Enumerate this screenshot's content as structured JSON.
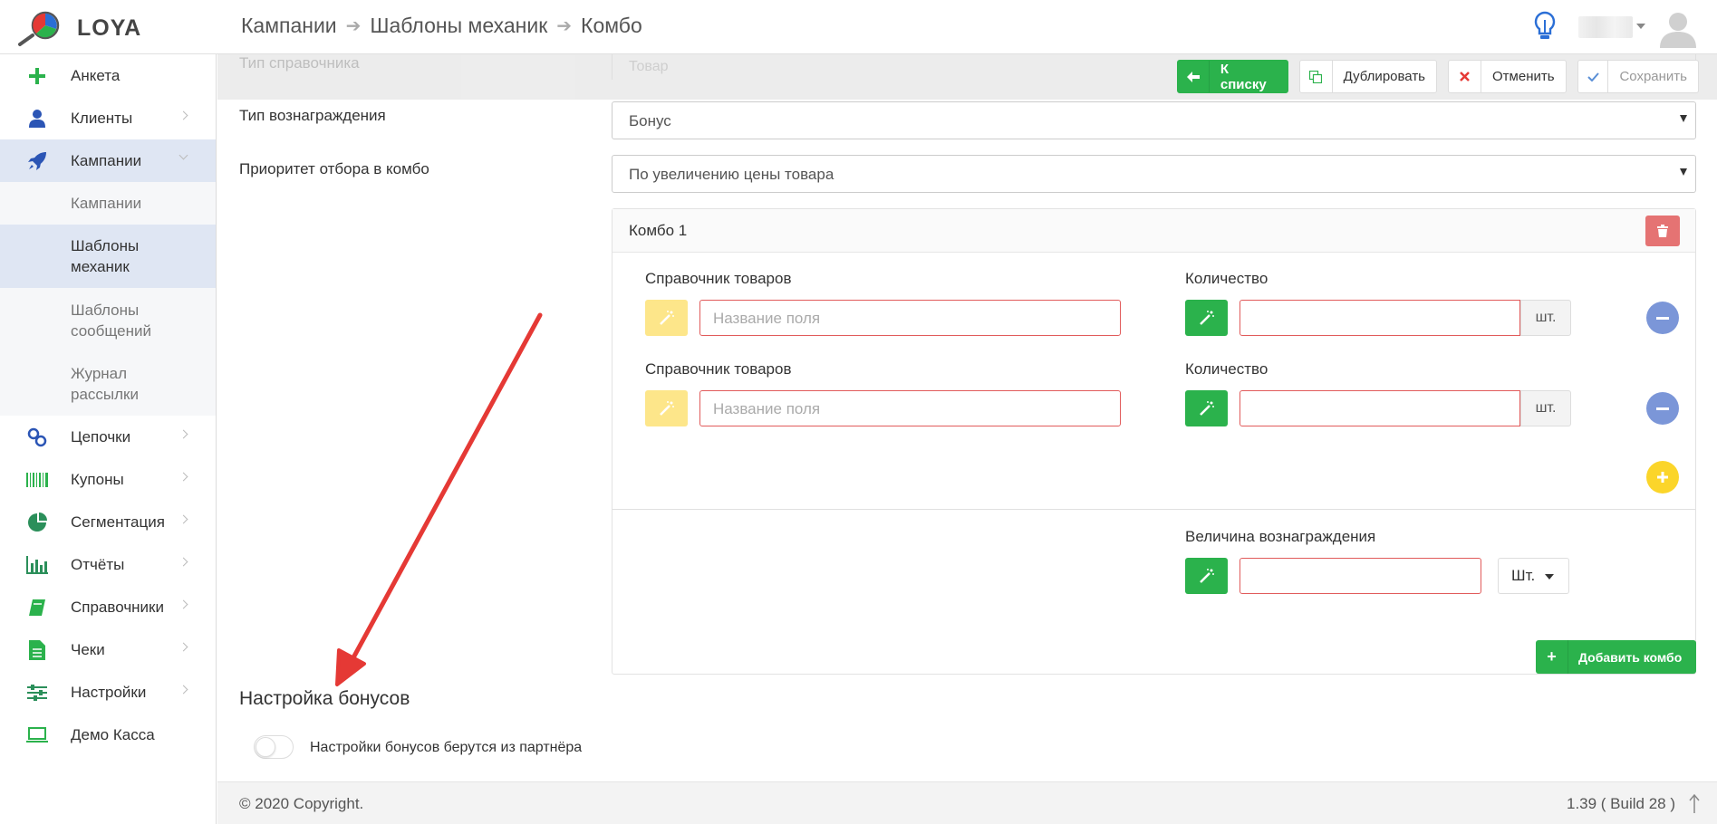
{
  "app": {
    "name": "LOYA"
  },
  "breadcrumb": {
    "items": [
      "Кампании",
      "Шаблоны механик",
      "Комбо"
    ]
  },
  "sidebar": {
    "items": [
      {
        "label": "Анкета",
        "icon": "plus-icon"
      },
      {
        "label": "Клиенты",
        "icon": "user-icon"
      },
      {
        "label": "Кампании",
        "icon": "rocket-icon"
      },
      {
        "label": "Цепочки",
        "icon": "link-icon"
      },
      {
        "label": "Купоны",
        "icon": "barcode-icon"
      },
      {
        "label": "Сегментация",
        "icon": "pie-chart-icon"
      },
      {
        "label": "Отчёты",
        "icon": "bar-chart-icon"
      },
      {
        "label": "Справочники",
        "icon": "book-icon"
      },
      {
        "label": "Чеки",
        "icon": "receipt-icon"
      },
      {
        "label": "Настройки",
        "icon": "sliders-icon"
      },
      {
        "label": "Демо Касса",
        "icon": "laptop-icon"
      }
    ],
    "sub_items": [
      "Кампании",
      "Шаблоны механик",
      "Шаблоны сообщений",
      "Журнал рассылки"
    ]
  },
  "toolbar": {
    "back_label": "К списку",
    "duplicate_label": "Дублировать",
    "cancel_label": "Отменить",
    "save_label": "Сохранить"
  },
  "form": {
    "ref_type_label": "Тип справочника",
    "ref_type_value": "Товар",
    "reward_type_label": "Тип вознаграждения",
    "reward_type_value": "Бонус",
    "priority_label": "Приоритет отбора в комбо",
    "priority_value": "По увеличению цены товара"
  },
  "combo": {
    "title": "Комбо 1",
    "rows": [
      {
        "catalog_label": "Справочник товаров",
        "catalog_placeholder": "Название поля",
        "qty_label": "Количество",
        "unit": "шт."
      },
      {
        "catalog_label": "Справочник товаров",
        "catalog_placeholder": "Название поля",
        "qty_label": "Количество",
        "unit": "шт."
      }
    ],
    "reward_label": "Величина вознаграждения",
    "reward_unit": "Шт."
  },
  "add_combo_label": "Добавить комбо",
  "bonus_settings": {
    "title": "Настройка бонусов",
    "toggle_label": "Настройки бонусов берутся из партнёра"
  },
  "footer": {
    "copyright": "© 2020 Copyright.",
    "build": "1.39 ( Build 28 )"
  },
  "colors": {
    "green": "#2bb24c",
    "accent_blue": "#2b55b5",
    "danger": "#e15b5b",
    "active_nav": "#dfe6f3",
    "annotation_red": "#e53935"
  }
}
